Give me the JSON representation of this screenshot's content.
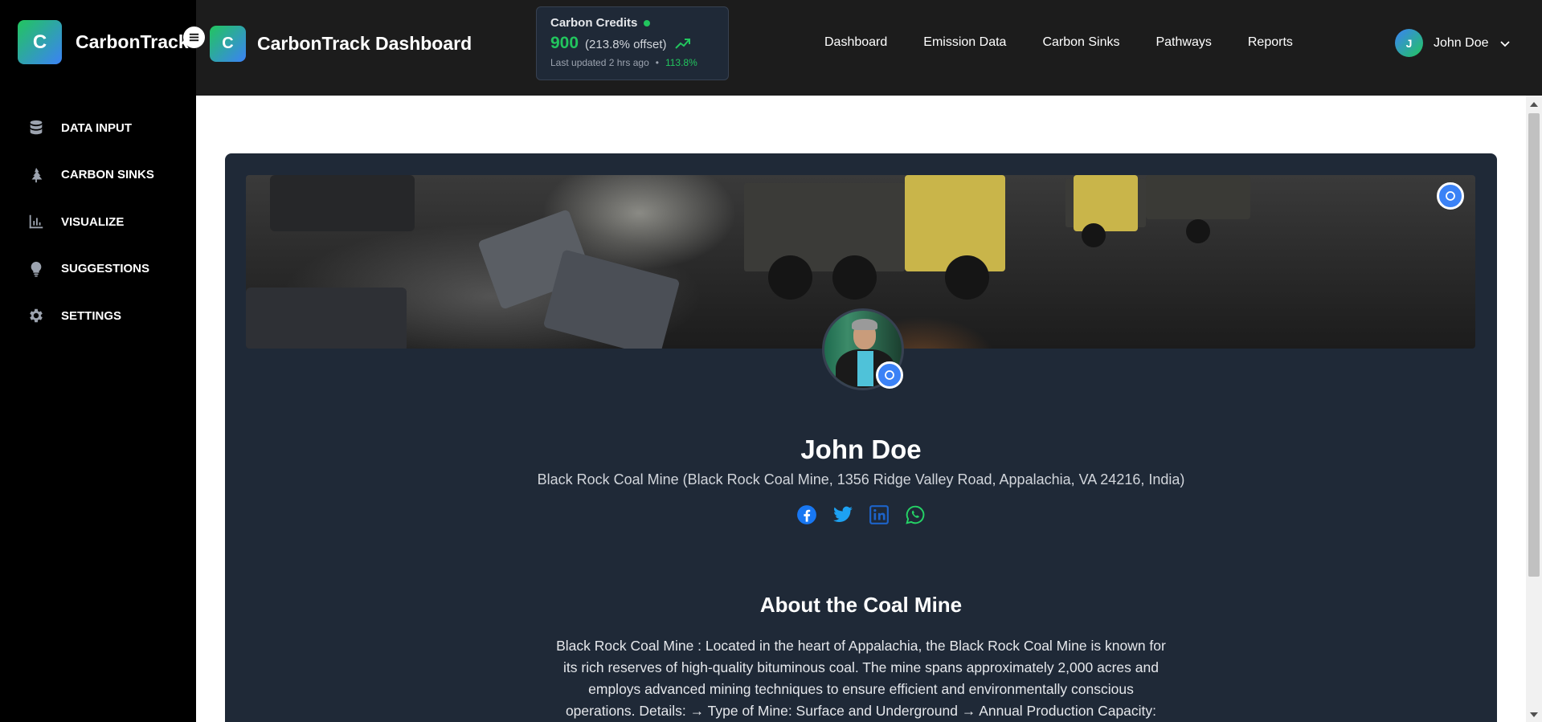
{
  "sidebar": {
    "brand_letter": "C",
    "brand_name": "CarbonTrack",
    "items": [
      {
        "label": "DATA INPUT",
        "icon": "database-icon"
      },
      {
        "label": "CARBON SINKS",
        "icon": "tree-icon"
      },
      {
        "label": "VISUALIZE",
        "icon": "bar-chart-icon"
      },
      {
        "label": "SUGGESTIONS",
        "icon": "lightbulb-icon"
      },
      {
        "label": "SETTINGS",
        "icon": "gear-icon"
      }
    ]
  },
  "header": {
    "brand_letter": "C",
    "title": "CarbonTrack Dashboard",
    "credits": {
      "title": "Carbon Credits",
      "value": "900",
      "offset": "(213.8% offset)",
      "updated": "Last updated 2 hrs ago",
      "separator": "•",
      "change": "113.8%"
    },
    "nav": [
      "Dashboard",
      "Emission Data",
      "Carbon Sinks",
      "Pathways",
      "Reports"
    ],
    "user": {
      "initial": "J",
      "name": "John Doe"
    }
  },
  "profile": {
    "name": "John Doe",
    "location": "Black Rock Coal Mine (Black Rock Coal Mine, 1356 Ridge Valley Road, Appalachia, VA 24216, India)",
    "socials": [
      "facebook-icon",
      "twitter-icon",
      "linkedin-icon",
      "whatsapp-icon"
    ]
  },
  "about": {
    "title": "About the Coal Mine",
    "text": "Black Rock Coal Mine : Located in the heart of Appalachia, the Black Rock Coal Mine is known for its rich reserves of high-quality bituminous coal. The mine spans approximately 2,000 acres and employs advanced mining techniques to ensure efficient and environmentally conscious operations. Details: → Type of Mine: Surface and Underground → Annual Production Capacity:"
  },
  "colors": {
    "accent_blue": "#3b82f6",
    "accent_green": "#22c55e",
    "sidebar_bg": "#000000",
    "header_bg": "#1c1c1c",
    "card_bg": "#1f2937"
  }
}
